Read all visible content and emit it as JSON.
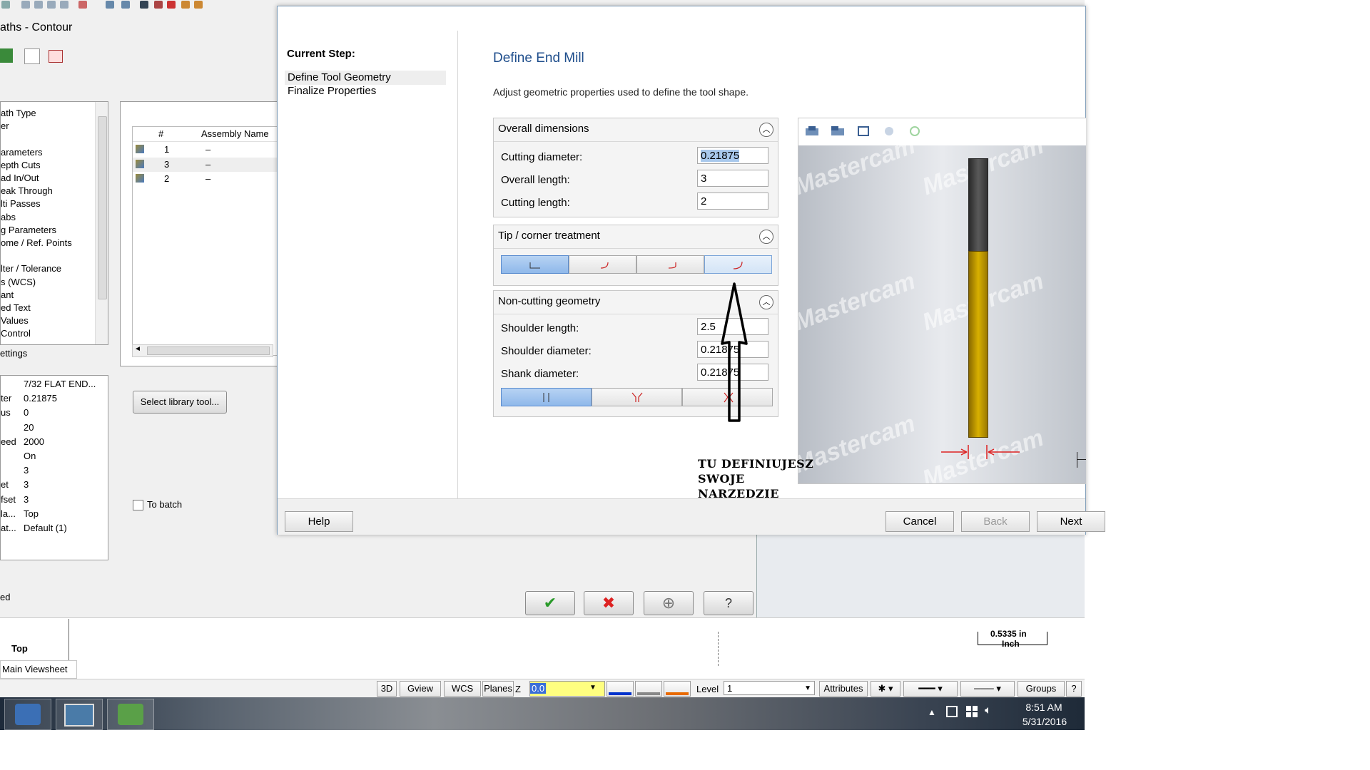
{
  "app": {
    "panel_title": "aths - Contour",
    "tree_items": [
      "ath Type",
      "er",
      "",
      "arameters",
      "epth Cuts",
      "ad In/Out",
      "eak Through",
      "lti Passes",
      "abs",
      "g Parameters",
      "ome / Ref. Points",
      "",
      "lter / Tolerance",
      "s (WCS)",
      "ant",
      "ed Text",
      "Values",
      "Control"
    ],
    "settings_title": "ettings",
    "settings_rows": [
      {
        "k": "",
        "v": "7/32 FLAT END..."
      },
      {
        "k": "ter",
        "v": "0.21875"
      },
      {
        "k": "us",
        "v": "0"
      },
      {
        "k": "",
        "v": "20"
      },
      {
        "k": "eed",
        "v": "2000"
      },
      {
        "k": "",
        "v": "On"
      },
      {
        "k": "",
        "v": "3"
      },
      {
        "k": "et",
        "v": "3"
      },
      {
        "k": "fset",
        "v": "3"
      },
      {
        "k": "la...",
        "v": "Top"
      },
      {
        "k": "at...",
        "v": "Default (1)"
      }
    ],
    "assembly": {
      "headers": [
        "#",
        "Assembly Name"
      ],
      "rows": [
        {
          "num": "1",
          "name": "–"
        },
        {
          "num": "3",
          "name": "–"
        },
        {
          "num": "2",
          "name": "–"
        }
      ]
    },
    "select_library_label": "Select library tool...",
    "to_batch_label": "To batch",
    "ed_label": "ed",
    "view_label": "Top",
    "scale_value": "0.5335 in",
    "scale_unit": "Inch",
    "main_viewsheet": "Main Viewsheet"
  },
  "statusbar": {
    "btn_3d": "3D",
    "btn_gview": "Gview",
    "btn_wcs": "WCS",
    "btn_planes": "Planes",
    "z_label": "Z",
    "z_value": "0.0",
    "level_label": "Level",
    "level_value": "1",
    "attributes_label": "Attributes",
    "groups_label": "Groups",
    "help_label": "?"
  },
  "taskbar": {
    "time": "8:51 AM",
    "date": "5/31/2016"
  },
  "dialog": {
    "current_step_label": "Current Step:",
    "steps": [
      "Define Tool Geometry",
      "Finalize Properties"
    ],
    "heading": "Define End Mill",
    "description": "Adjust geometric properties used to define the tool shape.",
    "overall": {
      "title": "Overall dimensions",
      "fields": [
        {
          "label": "Cutting diameter:",
          "value": "0.21875"
        },
        {
          "label": "Overall length:",
          "value": "3"
        },
        {
          "label": "Cutting length:",
          "value": "2"
        }
      ]
    },
    "tip": {
      "title": "Tip / corner treatment"
    },
    "noncutting": {
      "title": "Non-cutting geometry",
      "fields": [
        {
          "label": "Shoulder length:",
          "value": "2.5"
        },
        {
          "label": "Shoulder diameter:",
          "value": "0.21875"
        },
        {
          "label": "Shank diameter:",
          "value": "0.21875"
        }
      ]
    },
    "help_btn": "Help",
    "cancel_btn": "Cancel",
    "back_btn": "Back",
    "next_btn": "Next",
    "watermark": "Mastercam"
  },
  "annotation": {
    "line1": "TU DEFINIUJESZ",
    "line2": "SWOJE",
    "line3": "NARZEDZIE"
  }
}
